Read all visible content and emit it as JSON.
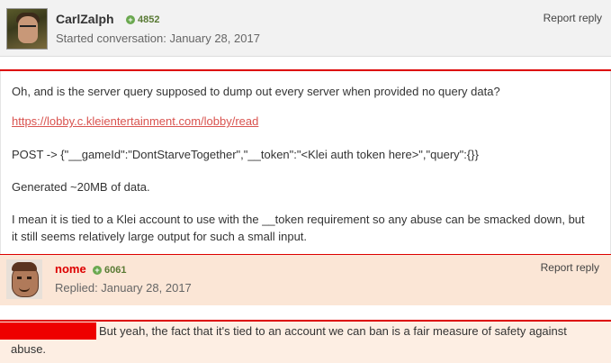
{
  "post1": {
    "author": "CarlZalph",
    "reputation": "4852",
    "meta": "Started conversation: January 28, 2017",
    "report_label": "Report reply",
    "paragraphs": {
      "p1": "Oh, and is the server query supposed to dump out every server when provided no query data?",
      "link": "https://lobby.c.kleientertainment.com/lobby/read",
      "p3": "POST -> {\"__gameId\":\"DontStarveTogether\",\"__token\":\"<Klei auth token here>\",\"query\":{}}",
      "p4": "Generated ~20MB of data.",
      "p5": "I mean it is tied to a Klei account to use with the __token requirement so any abuse can be smacked down, but it still seems relatively large output for such a small input."
    }
  },
  "post2": {
    "author": "nome",
    "reputation": "6061",
    "meta": "Replied: January 28, 2017",
    "report_label": "Report reply",
    "body": "But yeah, the fact that it's tied to an account we can ban is a fair measure of safety against abuse."
  },
  "icons": {
    "reputation": "plus-circle-icon"
  },
  "colors": {
    "accent_red": "#dd0000",
    "reputation_green": "#6aa84f",
    "link": "#d9534f",
    "staff_bg": "#fbe6d6"
  }
}
